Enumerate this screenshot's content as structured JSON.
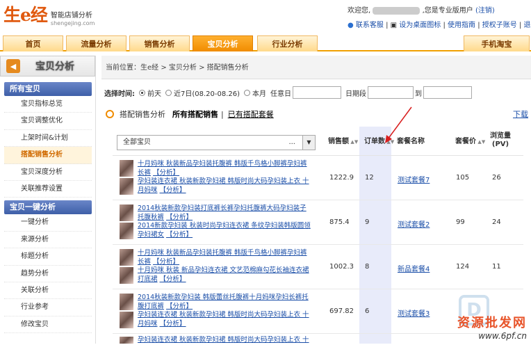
{
  "logo": {
    "big": "生e经",
    "slogan": "智能店铺分析",
    "domain": "shengejing.com"
  },
  "topbar": {
    "welcome_prefix": "欢迎您,",
    "welcome_suffix": ",您是专业版用户",
    "logout": "(注销)",
    "links": [
      "联系客服",
      "设为桌面图标",
      "使用指南",
      "授权子账号",
      "退出"
    ]
  },
  "nav": {
    "tabs": [
      "首页",
      "流量分析",
      "销售分析",
      "宝贝分析",
      "行业分析"
    ],
    "active": "宝贝分析",
    "mobile": "手机淘宝"
  },
  "sidebar": {
    "title": "宝贝分析",
    "group1": "所有宝贝",
    "items1": [
      "宝贝指标总览",
      "宝贝调整优化",
      "上架时间&计划",
      "搭配销售分析",
      "宝贝深度分析",
      "关联推荐设置"
    ],
    "active_item": "搭配销售分析",
    "group2": "宝贝一键分析",
    "items2": [
      "一键分析",
      "来源分析",
      "标题分析",
      "趋势分析",
      "关联分析",
      "行业参考",
      "修改宝贝"
    ]
  },
  "breadcrumb": "当前位置：生e经 > 宝贝分析 > 搭配销售分析",
  "filter": {
    "label": "选择时间:",
    "options": [
      "前天",
      "近7日(08.20-08.26)",
      "本月"
    ],
    "selected": "前天",
    "any_date": "任意日",
    "date_range": "日期段",
    "to": "到"
  },
  "section": {
    "title": "搭配销售分析",
    "link1": "所有搭配销售",
    "divider": "|",
    "link2": "已有搭配套餐",
    "download": "下载"
  },
  "table": {
    "select_value": "全部宝贝",
    "select_dots": "...",
    "headers": {
      "sales": "销售额",
      "orders": "订单数",
      "package": "套餐名称",
      "price": "套餐价",
      "pv": "浏览量",
      "pv_unit": "(PV)"
    },
    "rows": [
      {
        "items": [
          {
            "text": "十月妈咪 秋装新品孕妇装托腹裤 韩版千鸟格小脚裤孕妇裤长裤",
            "tag": "【分析】"
          },
          {
            "text": "孕妇装连衣裙 秋装新款孕妇裙 韩版时尚大码孕妇装上衣 十月妈咪",
            "tag": "【分析】"
          }
        ],
        "sales": "1222.9",
        "orders": "12",
        "package": "测试套餐7",
        "price": "105",
        "pv": "26"
      },
      {
        "items": [
          {
            "text": "2014秋装新款孕妇装打底裤长裤孕妇托腹裤大码孕妇装子托腹秋裤",
            "tag": "【分析】"
          },
          {
            "text": "2014新款孕妇装 秋装时尚孕妇连衣裙 条纹孕妇装韩版圆领孕妇裙女",
            "tag": "【分析】"
          }
        ],
        "sales": "875.4",
        "orders": "9",
        "package": "测试套餐2",
        "price": "99",
        "pv": "24"
      },
      {
        "items": [
          {
            "text": "十月妈咪 秋装新品孕妇装托腹裤 韩版千鸟格小脚裤孕妇裤长裤",
            "tag": "【分析】"
          },
          {
            "text": "十月妈咪 秋装 新品孕妇连衣裙 文艺范棉麻勾花长袖连衣裙打底裙",
            "tag": "【分析】"
          }
        ],
        "sales": "1002.3",
        "orders": "8",
        "package": "新品套餐4",
        "price": "124",
        "pv": "11"
      },
      {
        "items": [
          {
            "text": "2014秋装新款孕妇装 韩版蕾丝托腹裤十月妈咪孕妇长裤托腹打底裤",
            "tag": "【分析】"
          },
          {
            "text": "孕妇装连衣裙 秋装新款孕妇裙 韩版时尚大码孕妇装上衣 十月妈咪",
            "tag": "【分析】"
          }
        ],
        "sales": "697.82",
        "orders": "6",
        "package": "测试套餐3",
        "price": "",
        "pv": ""
      }
    ],
    "partial_row": "孕妇装连衣裙 秋装新款孕妇裙 韩版时尚大码孕妇装上衣 十"
  },
  "watermark": {
    "line1": "资源批发网",
    "line2": "www.6pf.cn",
    "logo": "D"
  }
}
